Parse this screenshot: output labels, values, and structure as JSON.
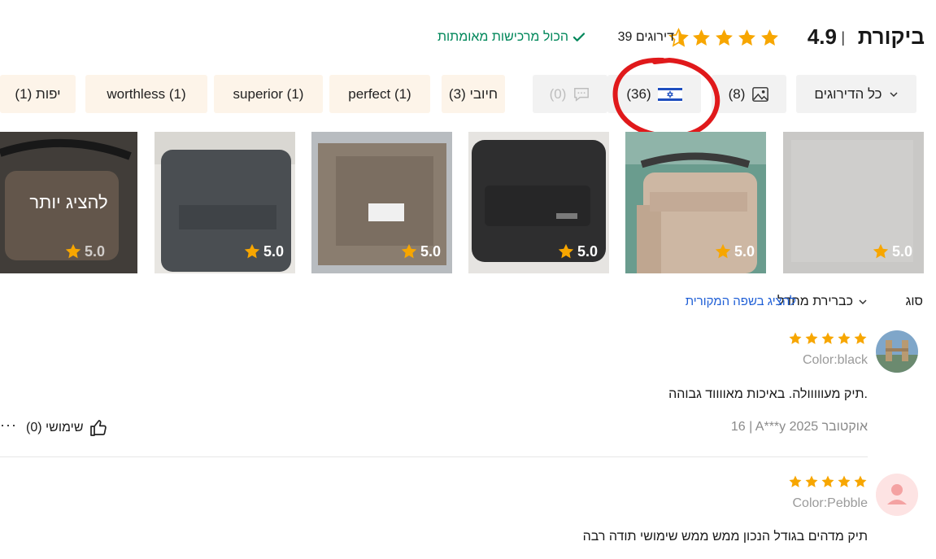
{
  "header": {
    "title": "ביקורת",
    "separator": "|",
    "rating": "4.9",
    "rating_count": "39 דירוגים",
    "verified": "הכול מרכישות מאומתות",
    "star_color": "#f7a600",
    "verified_color": "#00875a"
  },
  "filters": {
    "all": "כל הדירוגים",
    "photos_count": "(8)",
    "israel_count": "(36)",
    "comments_count": "(0)",
    "tags": [
      {
        "label": "חיובי (3)"
      },
      {
        "label": "perfect (1)"
      },
      {
        "label": "superior (1)"
      },
      {
        "label": "worthless (1)"
      },
      {
        "label": "יפות (1)"
      }
    ]
  },
  "photos": {
    "scores": [
      "5.0",
      "5.0",
      "5.0",
      "5.0",
      "5.0",
      "5.0"
    ],
    "show_more": "להציג יותר"
  },
  "sort": {
    "label": "סוג",
    "value": "כברירת מחדל",
    "original_language": "להציג בשפה המקורית"
  },
  "reviews": [
    {
      "color": "Color:black",
      "text": "תיק מעווווולה. באיכות מאווווד גבוהה.",
      "meta": "16 | A***y אוקטובר 2025",
      "helpful": "שימושי (0)"
    },
    {
      "color": "Color:Pebble",
      "text": "תיק מדהים בגודל הנכון ממש ממש שימושי תודה רבה"
    }
  ],
  "more_menu": "···"
}
